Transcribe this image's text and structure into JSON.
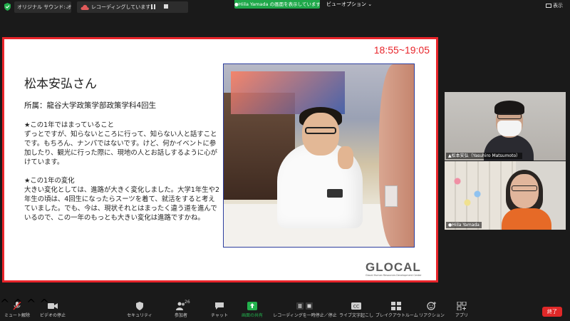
{
  "topbar": {
    "audio_label": "オリジナル サウンド: オフ",
    "recording_label": "レコーディングしています...",
    "share_banner": "●Hiila Yamada の画面を表示しています",
    "view_options": "ビューオプション ⌄",
    "display_label": "表示"
  },
  "slide": {
    "time": "18:55~19:05",
    "title": "松本安弘さん",
    "affiliation": "所属：龍谷大学政策学部政策学科4回生",
    "section1_heading": "★この1年ではまっていること",
    "section1_text": "ずっとですが、知らないところに行って、知らない人と話すことです。もちろん、ナンパではないです。けど、何かイベントに参加したり、観光に行った際に、現地の人とお話しするように心がけています。",
    "section2_heading": "★この1年の変化",
    "section2_text": "大きい変化としては、進路が大きく変化しました。大学1年生や2年生の頃は、4回生になったらスーツを着て、就活をすると考えていました。でも、今は、現状それとはまったく違う道を進んでいるので、この一年のもっとも大きい変化は進路ですかね。",
    "logo_word": "GLOCAL",
    "logo_sub": "Glocal Human Resources Development Center"
  },
  "participants": [
    {
      "name": "▲松本安弘（Yasuhiro Matsumoto）"
    },
    {
      "name": "●Hiila Yamada"
    }
  ],
  "toolbar": {
    "unmute": "ミュート解除",
    "stop_video": "ビデオの停止",
    "security": "セキュリティ",
    "participants": "参加者",
    "participant_count": "26",
    "chat": "チャット",
    "share": "画面の共有",
    "pause_record": "レコーディングを一時停止／停止",
    "captions": "ライブ文字起こし",
    "breakout": "ブレイクアウトルーム",
    "reactions": "リアクション",
    "apps": "アプリ",
    "end": "終了"
  },
  "colors": {
    "share_border": "#e8242a",
    "banner_green": "#1fa84a",
    "end_red": "#e02828",
    "share_icon_green": "#23b14d"
  }
}
